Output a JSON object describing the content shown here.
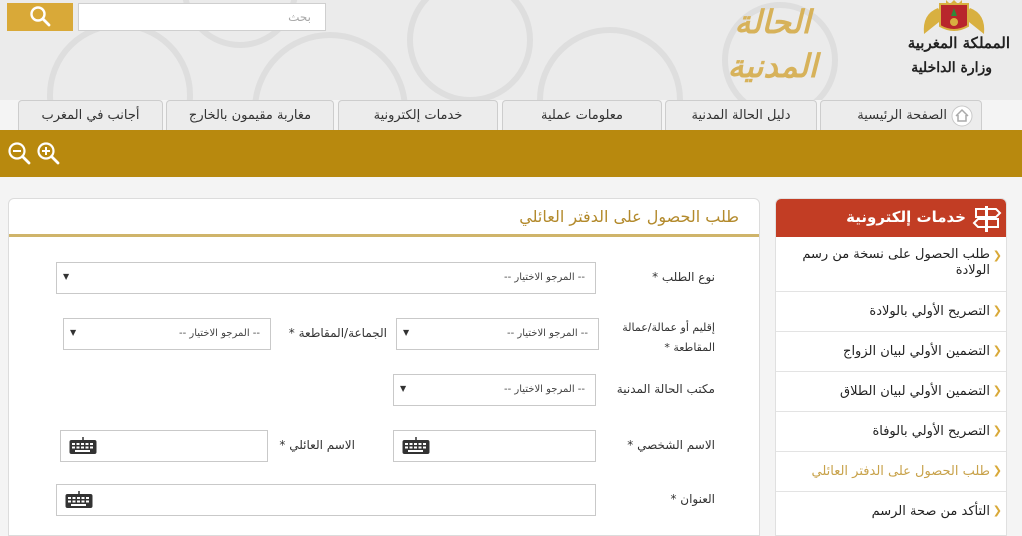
{
  "header": {
    "search_placeholder": "بحث",
    "brand_title": "الحالة المدنية",
    "kingdom": "المملكة المغربية",
    "ministry": "وزارة الداخلية"
  },
  "nav": {
    "items": [
      {
        "label": "الصفحة الرئيسية"
      },
      {
        "label": "دليل الحالة المدنية"
      },
      {
        "label": "معلومات عملية"
      },
      {
        "label": "خدمات إلكترونية"
      },
      {
        "label": "مغاربة مقيمون بالخارج"
      },
      {
        "label": "أجانب في المغرب"
      }
    ]
  },
  "sidebar": {
    "title": "خدمات إلكترونية",
    "items": [
      {
        "label": "طلب الحصول على نسخة من رسم الولادة"
      },
      {
        "label": "التصريح الأولي بالولادة"
      },
      {
        "label": "التضمين الأولي لبيان الزواج"
      },
      {
        "label": "التضمين الأولي لبيان الطلاق"
      },
      {
        "label": "التصريح الأولي بالوفاة"
      },
      {
        "label": "طلب الحصول على الدفتر العائلي",
        "active": true
      },
      {
        "label": "التأكد من صحة الرسم"
      }
    ]
  },
  "form": {
    "title": "طلب الحصول على الدفتر العائلي",
    "request_type_label": "نوع الطلب *",
    "prefecture_label_1": "إقليم أو عمالة/عمالة",
    "prefecture_label_2": "المقاطعة *",
    "commune_label": "الجماعة/المقاطعة *",
    "office_label": "مكتب الحالة المدنية",
    "first_name_label": "الاسم الشخصي *",
    "family_name_label": "الاسم العائلي *",
    "address_label": "العنوان *",
    "select_placeholder": "-- المرجو الاختيار --"
  },
  "colors": {
    "gold": "#d9a938",
    "toolbar": "#b8890e",
    "sidebar_header": "#c23d24",
    "title_gold": "#b38a2c"
  }
}
